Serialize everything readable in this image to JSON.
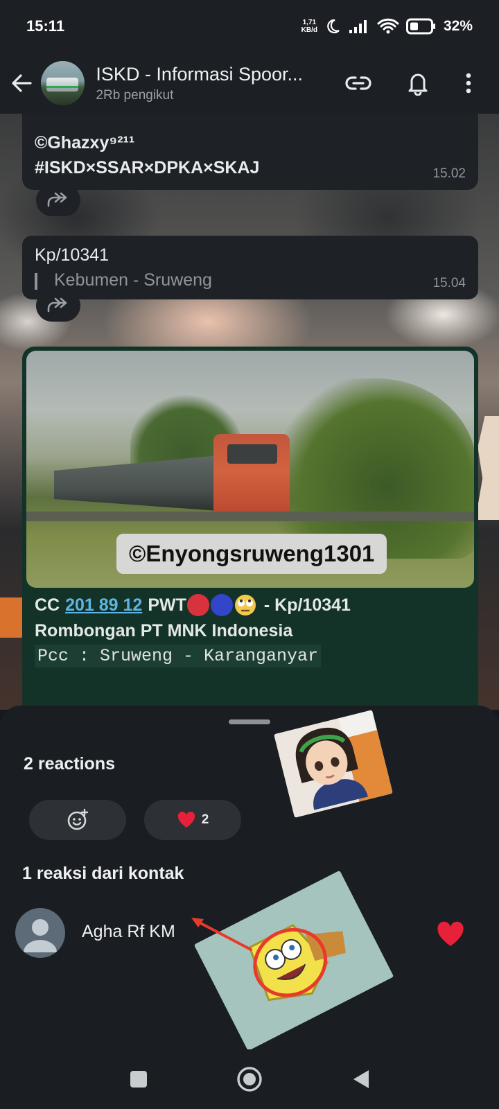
{
  "status_bar": {
    "time": "15:11",
    "net_speed_value": "1,71",
    "net_speed_unit": "KB/d",
    "battery": "32%"
  },
  "header": {
    "title": "ISKD - Informasi Spoor...",
    "subtitle": "2Rb pengikut",
    "icons": [
      "back-arrow-icon",
      "link-icon",
      "bell-icon",
      "more-vert-icon"
    ]
  },
  "messages": [
    {
      "lines": [
        "©Ghazxy⁹²¹¹",
        "#ISKD×SSAR×DPKA×SKAJ"
      ],
      "time": "15.02"
    },
    {
      "title": "Kp/10341",
      "quote": "Kebumen - Sruweng",
      "time": "15.04"
    }
  ],
  "photo_post": {
    "watermark": "©Enyongsruweng1301",
    "caption": {
      "prefix": "CC",
      "link": "201 89 12",
      "mid": "PWT",
      "suffix": "- Kp/10341",
      "line2": "Rombongan PT MNK Indonesia",
      "line3": "Pcc : Sruweng - Karanganyar"
    },
    "emoji_colors": [
      "#d9323f",
      "#3345c9"
    ]
  },
  "reactions_sheet": {
    "title": "2 reactions",
    "chips": [
      {
        "icon": "add-reaction-icon",
        "count": ""
      },
      {
        "icon": "heart-icon",
        "count": "2"
      }
    ],
    "contacts_title": "1 reaksi dari kontak",
    "contacts": [
      {
        "name": "Agha Rf KM",
        "reaction": "heart-icon"
      }
    ]
  },
  "nav_bar": {
    "icons": [
      "recent-apps-icon",
      "home-icon",
      "back-icon"
    ]
  },
  "colors": {
    "accent_link": "#5fb4e2",
    "heart": "#e8213a",
    "annotation_red": "#e83a2c",
    "post_bg": "#133328"
  }
}
